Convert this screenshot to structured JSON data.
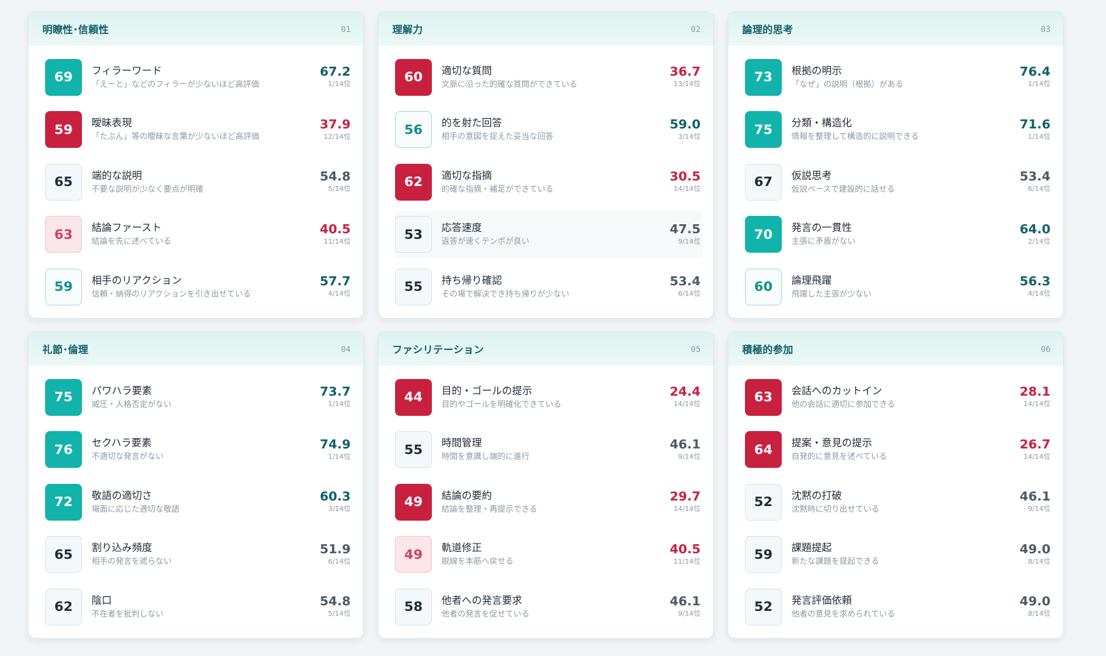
{
  "colors": {
    "accent_teal": "#12b3aa",
    "accent_red": "#c8213f",
    "header_bg": "#ddf4f1",
    "title_text": "#11606a"
  },
  "cards": [
    {
      "title": "明瞭性･信頼性",
      "number": "01",
      "items": [
        {
          "score": "69",
          "style": "teal",
          "label": "フィラーワード",
          "desc": "「えーと」などのフィラーが少ないほど高評価",
          "value": "67.2",
          "value_color": "teal",
          "rank": "1/14位"
        },
        {
          "score": "59",
          "style": "red",
          "label": "曖昧表現",
          "desc": "「たぶん」等の曖昧な言葉が少ないほど高評価",
          "value": "37.9",
          "value_color": "red",
          "rank": "12/14位"
        },
        {
          "score": "65",
          "style": "neutral",
          "label": "端的な説明",
          "desc": "不要な説明が少なく要点が明確",
          "value": "54.8",
          "value_color": "gray",
          "rank": "5/14位"
        },
        {
          "score": "63",
          "style": "pink",
          "label": "結論ファースト",
          "desc": "結論を先に述べている",
          "value": "40.5",
          "value_color": "red",
          "rank": "11/14位"
        },
        {
          "score": "59",
          "style": "tealo",
          "label": "相手のリアクション",
          "desc": "信頼・納得のリアクションを引き出せている",
          "value": "57.7",
          "value_color": "teal",
          "rank": "4/14位"
        }
      ]
    },
    {
      "title": "理解力",
      "number": "02",
      "items": [
        {
          "score": "60",
          "style": "red",
          "label": "適切な質問",
          "desc": "文脈に沿った的確な質問ができている",
          "value": "36.7",
          "value_color": "red",
          "rank": "13/14位"
        },
        {
          "score": "56",
          "style": "tealo",
          "label": "的を射た回答",
          "desc": "相手の意図を捉えた妥当な回答",
          "value": "59.0",
          "value_color": "teal",
          "rank": "3/14位"
        },
        {
          "score": "62",
          "style": "red",
          "label": "適切な指摘",
          "desc": "的確な指摘・補足ができている",
          "value": "30.5",
          "value_color": "red",
          "rank": "14/14位"
        },
        {
          "score": "53",
          "style": "neutral",
          "label": "応答速度",
          "desc": "返答が速くテンポが良い",
          "value": "47.5",
          "value_color": "gray",
          "rank": "9/14位",
          "highlight": true
        },
        {
          "score": "55",
          "style": "neutral",
          "label": "持ち帰り確認",
          "desc": "その場で解決でき持ち帰りが少ない",
          "value": "53.4",
          "value_color": "gray",
          "rank": "6/14位"
        }
      ]
    },
    {
      "title": "論理的思考",
      "number": "03",
      "items": [
        {
          "score": "73",
          "style": "teal",
          "label": "根拠の明示",
          "desc": "「なぜ」の説明（根拠）がある",
          "value": "76.4",
          "value_color": "teal",
          "rank": "1/14位"
        },
        {
          "score": "75",
          "style": "teal",
          "label": "分類・構造化",
          "desc": "情報を整理して構造的に説明できる",
          "value": "71.6",
          "value_color": "teal",
          "rank": "1/14位"
        },
        {
          "score": "67",
          "style": "neutral",
          "label": "仮説思考",
          "desc": "仮説ベースで建設的に話せる",
          "value": "53.4",
          "value_color": "gray",
          "rank": "6/14位"
        },
        {
          "score": "70",
          "style": "teal",
          "label": "発言の一貫性",
          "desc": "主張に矛盾がない",
          "value": "64.0",
          "value_color": "teal",
          "rank": "2/14位"
        },
        {
          "score": "60",
          "style": "tealo",
          "label": "論理飛躍",
          "desc": "飛躍した主張が少ない",
          "value": "56.3",
          "value_color": "teal",
          "rank": "4/14位"
        }
      ]
    },
    {
      "title": "礼節･倫理",
      "number": "04",
      "items": [
        {
          "score": "75",
          "style": "teal",
          "label": "パワハラ要素",
          "desc": "威圧・人格否定がない",
          "value": "73.7",
          "value_color": "teal",
          "rank": "1/14位"
        },
        {
          "score": "76",
          "style": "teal",
          "label": "セクハラ要素",
          "desc": "不適切な発言がない",
          "value": "74.9",
          "value_color": "teal",
          "rank": "1/14位"
        },
        {
          "score": "72",
          "style": "teal",
          "label": "敬語の適切さ",
          "desc": "場面に応じた適切な敬語",
          "value": "60.3",
          "value_color": "teal",
          "rank": "3/14位"
        },
        {
          "score": "65",
          "style": "neutral",
          "label": "割り込み頻度",
          "desc": "相手の発言を遮らない",
          "value": "51.9",
          "value_color": "gray",
          "rank": "6/14位"
        },
        {
          "score": "62",
          "style": "neutral",
          "label": "陰口",
          "desc": "不在者を批判しない",
          "value": "54.8",
          "value_color": "gray",
          "rank": "5/14位"
        }
      ]
    },
    {
      "title": "ファシリテーション",
      "number": "05",
      "items": [
        {
          "score": "44",
          "style": "red",
          "label": "目的・ゴールの提示",
          "desc": "目的やゴールを明確化できている",
          "value": "24.4",
          "value_color": "red",
          "rank": "14/14位"
        },
        {
          "score": "55",
          "style": "neutral",
          "label": "時間管理",
          "desc": "時間を意識し端的に進行",
          "value": "46.1",
          "value_color": "gray",
          "rank": "9/14位"
        },
        {
          "score": "49",
          "style": "red",
          "label": "結論の要約",
          "desc": "結論を整理・再提示できる",
          "value": "29.7",
          "value_color": "red",
          "rank": "14/14位"
        },
        {
          "score": "49",
          "style": "pink",
          "label": "軌道修正",
          "desc": "脱線を本筋へ戻せる",
          "value": "40.5",
          "value_color": "red",
          "rank": "11/14位"
        },
        {
          "score": "58",
          "style": "neutral",
          "label": "他者への発言要求",
          "desc": "他者の発言を促せている",
          "value": "46.1",
          "value_color": "gray",
          "rank": "9/14位"
        }
      ]
    },
    {
      "title": "積極的参加",
      "number": "06",
      "items": [
        {
          "score": "63",
          "style": "red",
          "label": "会話へのカットイン",
          "desc": "他の会話に適切に参加できる",
          "value": "28.1",
          "value_color": "red",
          "rank": "14/14位"
        },
        {
          "score": "64",
          "style": "red",
          "label": "提案・意見の提示",
          "desc": "自発的に意見を述べている",
          "value": "26.7",
          "value_color": "red",
          "rank": "14/14位"
        },
        {
          "score": "52",
          "style": "neutral",
          "label": "沈黙の打破",
          "desc": "沈黙時に切り出せている",
          "value": "46.1",
          "value_color": "gray",
          "rank": "9/14位"
        },
        {
          "score": "59",
          "style": "neutral",
          "label": "課題提起",
          "desc": "新たな課題を提起できる",
          "value": "49.0",
          "value_color": "gray",
          "rank": "8/14位"
        },
        {
          "score": "52",
          "style": "neutral",
          "label": "発言評価依頼",
          "desc": "他者の意見を求められている",
          "value": "49.0",
          "value_color": "gray",
          "rank": "8/14位"
        }
      ]
    }
  ]
}
